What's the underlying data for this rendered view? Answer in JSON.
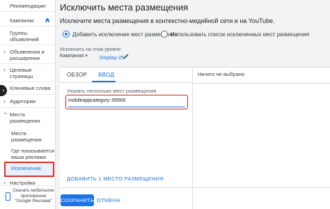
{
  "sidebar": {
    "items": [
      {
        "label": "Рекомендации"
      },
      {
        "label": "Кампании"
      },
      {
        "label": "Группы объявлений"
      },
      {
        "label": "Объявления и расширения"
      },
      {
        "label": "Целевые страницы"
      },
      {
        "label": "Ключевые слова"
      },
      {
        "label": "Аудитории"
      },
      {
        "label": "Места размещения"
      },
      {
        "label": "Места размещения"
      },
      {
        "label": "Где показывается ваша реклама"
      },
      {
        "label": "Исключения"
      },
      {
        "label": "Настройки"
      }
    ],
    "app_promo": "Скачать мобильное приложение \"Google Реклама\""
  },
  "page": {
    "title": "Исключить места размещения",
    "subtitle": "Исключите места размещения в контекстно-медийной сети и на YouTube.",
    "radio_add": "Добавить исключение мест размещения",
    "radio_list": "Использовать список исключенных мест размещения",
    "level_label": "Исключить на этом уровне:",
    "level_type": "Кампания",
    "level_name": "Display-25"
  },
  "panel": {
    "tabs": [
      "ОБЗОР",
      "ВВОД"
    ],
    "active_tab": "ВВОД",
    "right_header": "Ничего не выбрано",
    "field_label": "Указать несколько мест размещения",
    "input_value": "mobileappcategory::69500",
    "add_link": "ДОБАВИТЬ 1 МЕСТО РАЗМЕЩЕНИЯ",
    "save": "СОХРАНИТЬ",
    "cancel": "ОТМЕНА"
  },
  "colors": {
    "accent": "#1a73e8",
    "highlight": "#d93025"
  },
  "icons": [
    "home-icon",
    "pencil-icon",
    "phone-icon",
    "collapse-chevron-icon"
  ]
}
